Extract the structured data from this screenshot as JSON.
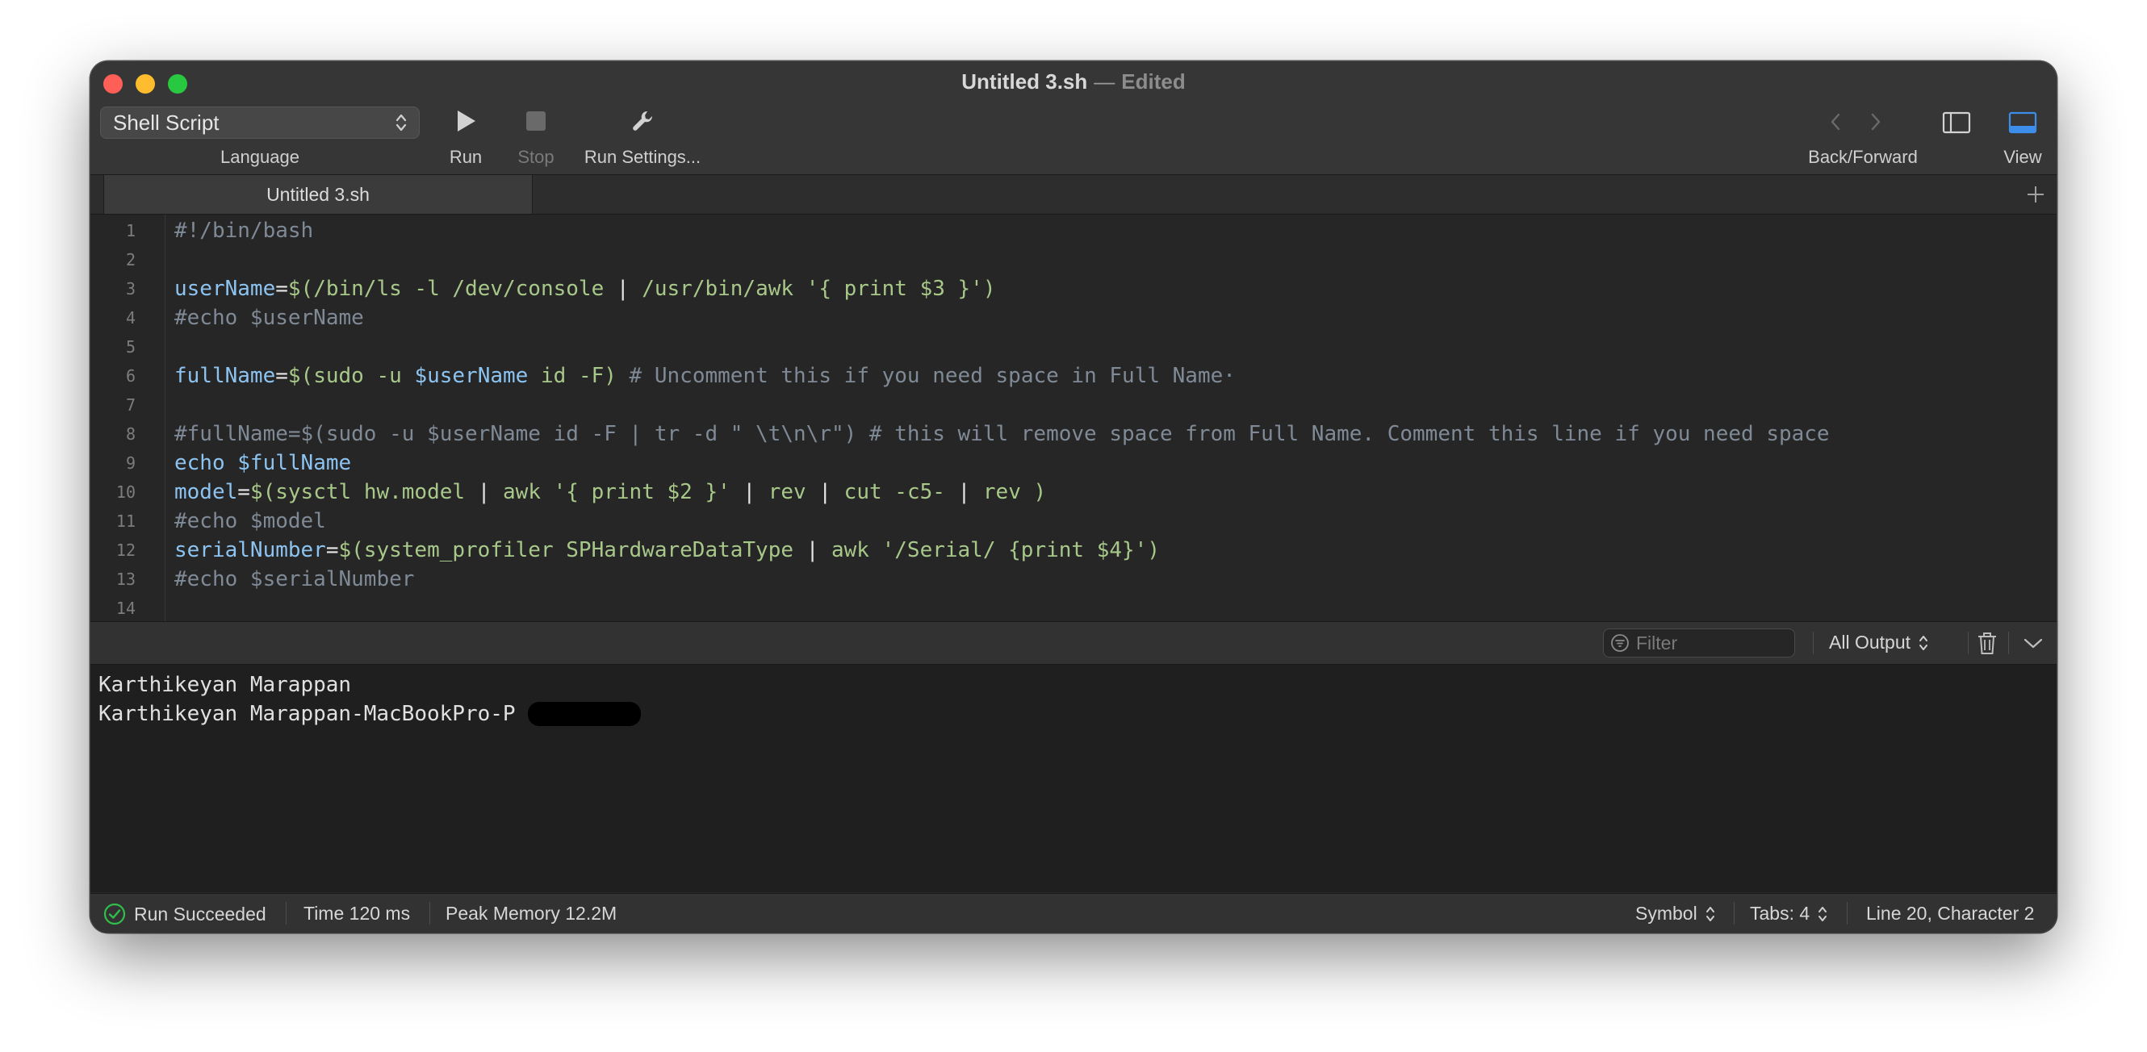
{
  "window": {
    "file_name": "Untitled 3.sh",
    "title_dash": "—",
    "edited": "Edited"
  },
  "toolbar": {
    "language_value": "Shell Script",
    "language_label": "Language",
    "run_label": "Run",
    "stop_label": "Stop",
    "run_settings_label": "Run Settings...",
    "back_forward_label": "Back/Forward",
    "view_label": "View"
  },
  "tabs": [
    {
      "label": "Untitled 3.sh",
      "active": true
    }
  ],
  "editor": {
    "lines": [
      {
        "n": "1",
        "text": "#!/bin/bash"
      },
      {
        "n": "2",
        "text": ""
      },
      {
        "n": "3",
        "text": "userName=$(/bin/ls -l /dev/console | /usr/bin/awk '{ print $3 }')"
      },
      {
        "n": "4",
        "text": "#echo $userName"
      },
      {
        "n": "5",
        "text": ""
      },
      {
        "n": "6",
        "text": "fullName=$(sudo -u $userName id -F) # Uncomment this if you need space in Full Name·"
      },
      {
        "n": "7",
        "text": ""
      },
      {
        "n": "8",
        "text": "#fullName=$(sudo -u $userName id -F | tr -d \" \\t\\n\\r\") # this will remove space from Full Name. Comment this line if you need space"
      },
      {
        "n": "9",
        "text": "echo $fullName"
      },
      {
        "n": "10",
        "text": "model=$(sysctl hw.model | awk '{ print $2 }' | rev | cut -c5- | rev )"
      },
      {
        "n": "11",
        "text": "#echo $model"
      },
      {
        "n": "12",
        "text": "serialNumber=$(system_profiler SPHardwareDataType | awk '/Serial/ {print $4}')"
      },
      {
        "n": "13",
        "text": "#echo $serialNumber"
      },
      {
        "n": "14",
        "text": ""
      }
    ]
  },
  "console_header": {
    "filter_placeholder": "Filter",
    "output_select": "All Output"
  },
  "console": {
    "lines": [
      "Karthikeyan Marappan",
      "Karthikeyan Marappan-MacBookPro-P"
    ]
  },
  "status": {
    "run_result": "Run Succeeded",
    "time": "Time 120 ms",
    "memory": "Peak Memory 12.2M",
    "symbol": "Symbol",
    "tabs": "Tabs: 4",
    "position": "Line 20, Character 2"
  },
  "colors": {
    "success": "#2fbf4a",
    "accent": "#3d8eea"
  }
}
